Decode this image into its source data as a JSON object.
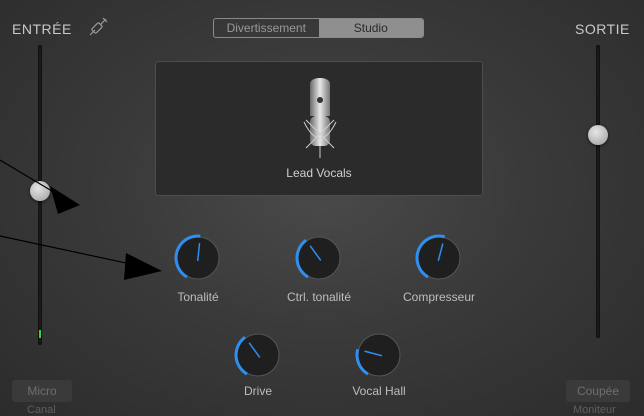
{
  "header": {
    "input_title": "ENTRÉE",
    "output_title": "SORTIE",
    "tabs": [
      {
        "label": "Divertissement",
        "selected": false
      },
      {
        "label": "Studio",
        "selected": true
      }
    ]
  },
  "input": {
    "level": 0.53,
    "micro_label": "Micro",
    "canal_label": "Canal",
    "meter_color": "#39d14a"
  },
  "output": {
    "level": 0.69,
    "coupee_label": "Coupée",
    "moniteur_label": "Moniteur"
  },
  "patch": {
    "name": "Lead Vocals",
    "icon": "microphone-icon"
  },
  "knobs": {
    "tonalite": {
      "label": "Tonalité",
      "value": 0.52
    },
    "ctrl_tonalite": {
      "label": "Ctrl. tonalité",
      "value": 0.38
    },
    "compresseur": {
      "label": "Compresseur",
      "value": 0.55
    },
    "drive": {
      "label": "Drive",
      "value": 0.38
    },
    "vocal_hall": {
      "label": "Vocal Hall",
      "value": 0.25
    }
  },
  "colors": {
    "accent": "#2f8ff0",
    "text": "#d8d8d8",
    "annotation": "#000000"
  }
}
